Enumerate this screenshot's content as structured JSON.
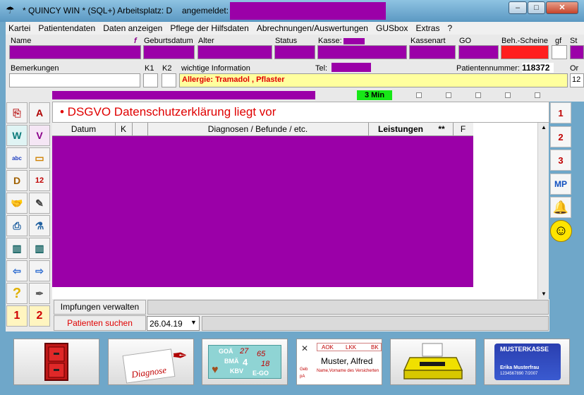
{
  "window": {
    "title": "* QUINCY WIN * (SQL+) Arbeitsplatz: D",
    "login_label": "angemeldet:",
    "min": "–",
    "max": "□",
    "close": "✕"
  },
  "menu": [
    "Kartei",
    "Patientendaten",
    "Daten anzeigen",
    "Pflege der Hilfsdaten",
    "Abrechnungen/Auswertungen",
    "GUSbox",
    "Extras",
    "?"
  ],
  "patient": {
    "labels": {
      "name": "Name",
      "f": "f",
      "geburtsdatum": "Geburtsdatum",
      "alter": "Alter",
      "status": "Status",
      "kasse": "Kasse:",
      "kassenart": "Kassenart",
      "go": "GO",
      "beh_scheine": "Beh.-Scheine",
      "gf": "gf",
      "st": "St",
      "bemerkungen": "Bemerkungen",
      "k1": "K1",
      "k2": "K2",
      "wichtige": "wichtige Information",
      "tel": "Tel:",
      "patientennummer": "Patientennummer:",
      "or": "Or"
    },
    "patientennummer": "118372",
    "wichtige_info": "Allergie: Tramadol ,  Pflaster",
    "timer": "3 Min",
    "right_value": "12"
  },
  "notice": "•  DSGVO Datenschutzerklärung liegt vor",
  "table": {
    "headers": [
      "Datum",
      "K",
      "",
      "Diagnosen / Befunde / etc.",
      "Leistungen",
      "**",
      "F"
    ]
  },
  "bottom": {
    "impfungen": "Impfungen verwalten",
    "patienten_suchen": "Patienten suchen",
    "date": "26.04.19"
  },
  "right_buttons": [
    "1",
    "2",
    "3",
    "MP"
  ],
  "big_buttons": {
    "diagnose": "Diagnose",
    "goae": [
      "GOÄ",
      "BMÄ",
      "KBV",
      "E-GO",
      "27",
      "65",
      "4",
      "18"
    ],
    "kv_header": [
      "AOK",
      "LKK",
      "BK"
    ],
    "kv_name": "Muster, Alfred",
    "kv_sub": "Name,Vorname des Versicherten",
    "kv_side": [
      "Geb",
      "pA"
    ],
    "kasse_title": "MUSTERKASSE",
    "kasse_name": "Erika Musterfrau",
    "kasse_num": "1234567890  7/2007"
  }
}
